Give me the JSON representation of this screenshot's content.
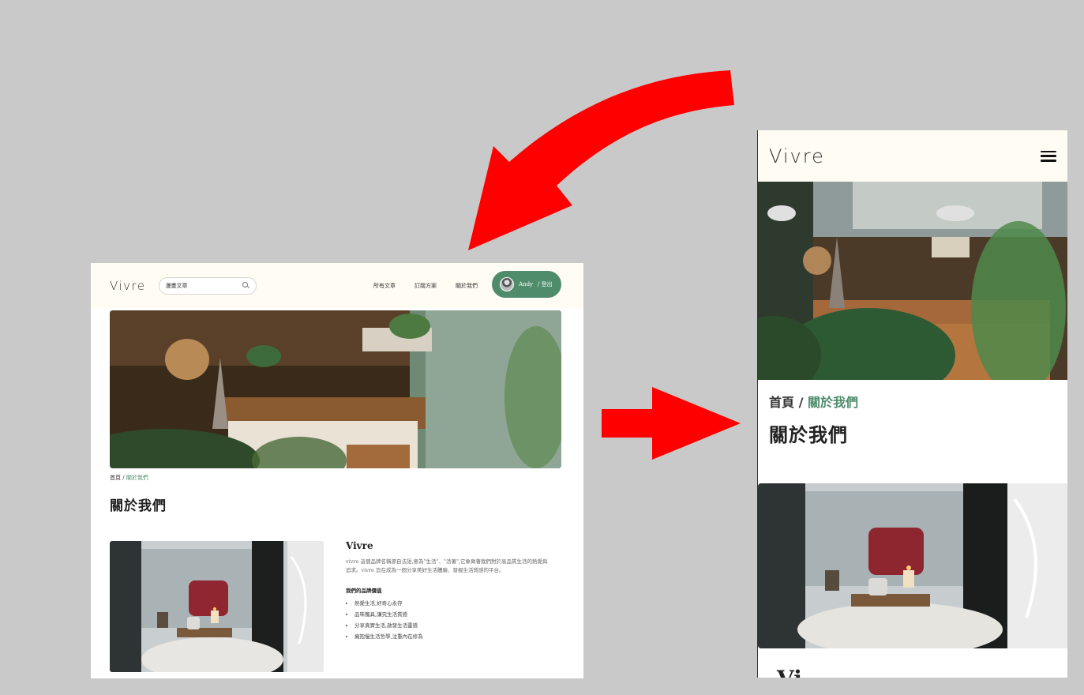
{
  "desktop": {
    "logo": "Vivre",
    "search_value": "漫畫文章",
    "nav": [
      "所有文章",
      "訂閱方案",
      "關於我們"
    ],
    "user": {
      "name": "Andy",
      "logout": "/ 登出"
    },
    "breadcrumb": {
      "home": "首頁",
      "separator": "/",
      "current": "關於我們"
    },
    "page_title": "關於我們",
    "about": {
      "heading": "Vivre",
      "description": "vivre 這個品牌名稱源自法語,意為\"生活\"、\"活著\",它象徵著我們對於高品質生活的熱愛與追求。vivre 旨在成為一個分享美好生活體驗、發掘生活質感的平台。",
      "values_title": "我們的品牌價值",
      "values": [
        "熱愛生活,好奇心永存",
        "品味獨具,講究生活質感",
        "分享真實生活,啟發生活靈感",
        "擁抱慢生活哲學,注重內在修為"
      ]
    }
  },
  "mobile": {
    "logo": "Vivre",
    "breadcrumb": {
      "home": "首頁",
      "separator": "/",
      "current": "關於我們"
    },
    "page_title": "關於我們",
    "peek_heading": "Vi"
  },
  "colors": {
    "accent": "#4f8c6b",
    "header_bg": "#fffcf3",
    "arrow": "#ff0000",
    "canvas": "#c9c9c9"
  },
  "icons": {
    "search": "search-icon",
    "menu": "hamburger-menu-icon",
    "avatar": "user-avatar"
  }
}
